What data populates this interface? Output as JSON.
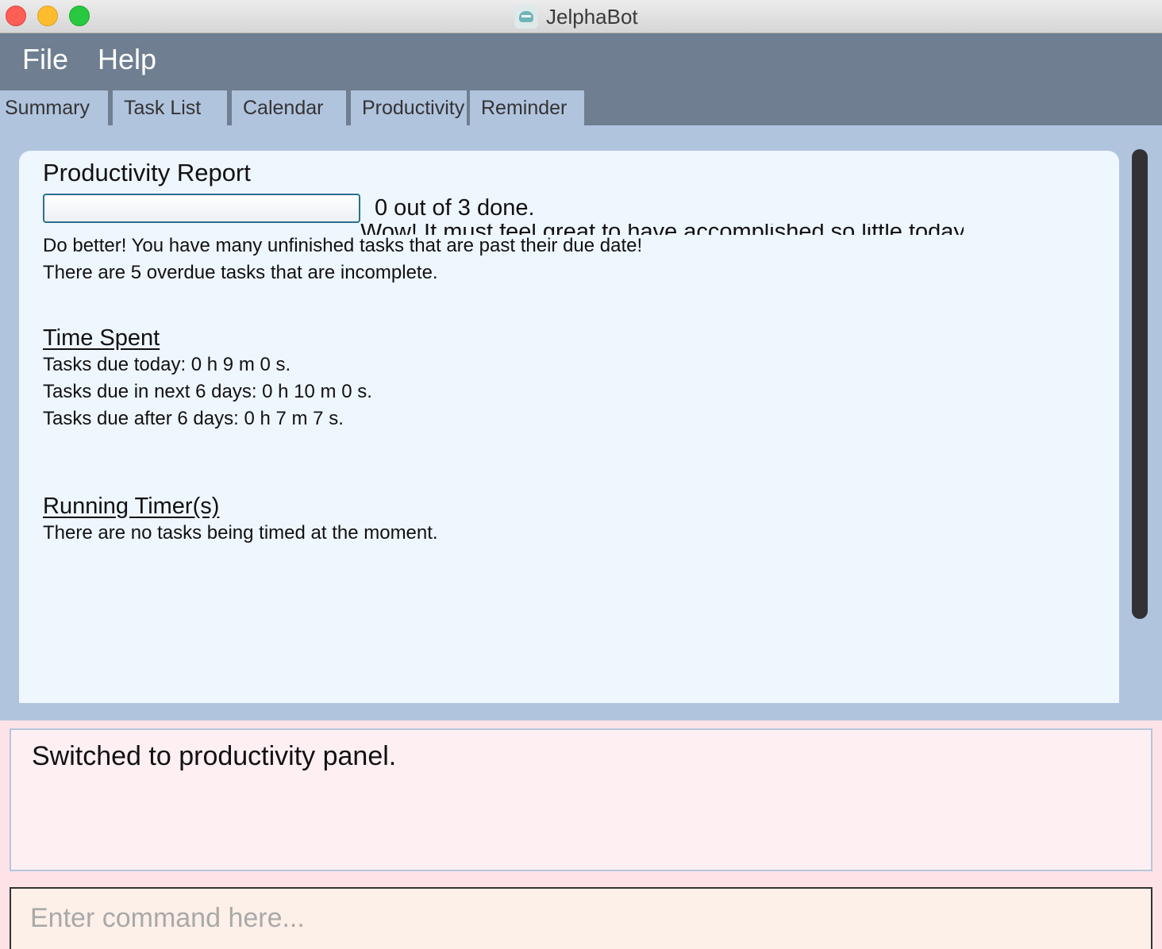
{
  "window": {
    "title": "JelphaBot",
    "app_icon": "jelphabot-robot-icon"
  },
  "menu": {
    "file": "File",
    "help": "Help"
  },
  "tabs": [
    "Summary",
    "Task List",
    "Calendar",
    "Productivity",
    "Reminder"
  ],
  "active_tab": "Productivity",
  "productivity": {
    "title": "Productivity Report",
    "progress": {
      "done": 0,
      "total": 3,
      "fraction": 0.0
    },
    "progress_text": "0 out of 3 done.",
    "clipped_message": "Wow! It must feel great to have accomplished so little today!",
    "overdue_message": "Do better! You have many unfinished tasks that are past their due date!",
    "overdue_count_text": "There are 5 overdue tasks that are incomplete.",
    "time_spent": {
      "title": "Time Spent",
      "lines": [
        "Tasks due today: 0 h 9 m 0 s.",
        "Tasks due in next 6 days: 0 h 10 m 0 s.",
        "Tasks due after 6 days: 0 h 7 m 7 s."
      ]
    },
    "running_timers": {
      "title": "Running Timer(s)",
      "text": "There are no tasks being timed at the moment."
    }
  },
  "result_display": {
    "text": "Switched to productivity panel."
  },
  "command_box": {
    "value": "",
    "placeholder": "Enter command here..."
  },
  "colors": {
    "menu_bg": "#6f7f91",
    "tab_bg": "#b1c4de",
    "panel_bg": "#eef6fe",
    "result_bg": "#feeff3",
    "command_bg": "#fdf0e8",
    "progress_border": "#2a6e8e"
  }
}
